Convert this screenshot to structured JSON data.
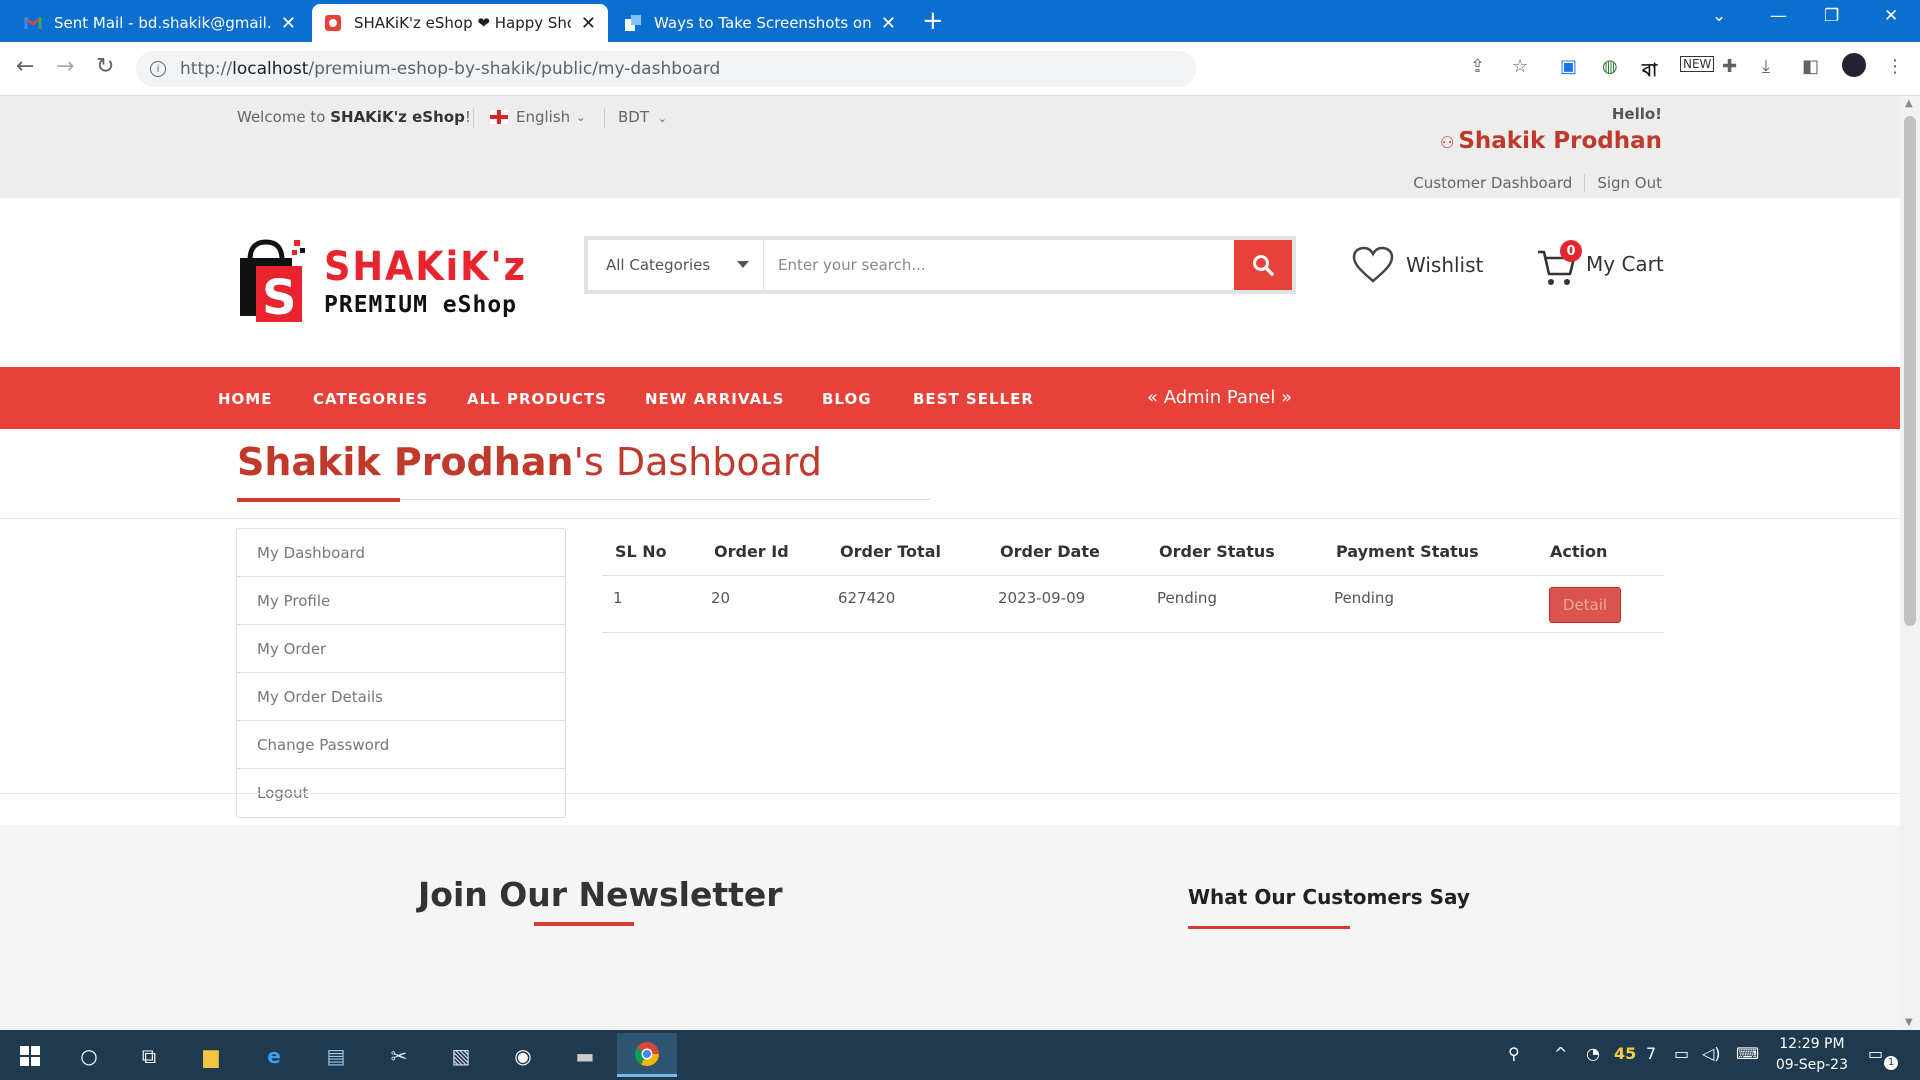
{
  "browser": {
    "tabs": [
      {
        "title": "Sent Mail - bd.shakik@gmail.com",
        "icon": "gmail-icon",
        "active": false
      },
      {
        "title": "SHAKiK'z eShop ❤ Happy Shopping",
        "icon": "shop-icon",
        "active": true
      },
      {
        "title": "Ways to Take Screenshots on Windows",
        "icon": "edge-doc-icon",
        "active": false
      }
    ],
    "url_prefix": "http://",
    "url_host": "localhost",
    "url_path": "/premium-eshop-by-shakik/public/my-dashboard",
    "new_tab": "+"
  },
  "topbar": {
    "welcome_prefix": "Welcome to ",
    "welcome_brand": "SHAKiK'z eShop",
    "welcome_suffix": "!",
    "language": "English",
    "currency": "BDT",
    "hello": "Hello!",
    "user_name": "Shakik Prodhan",
    "links": [
      "Customer Dashboard",
      "Sign Out"
    ]
  },
  "header": {
    "logo_line1": "SHAKiK'z",
    "logo_line2": "PREMIUM eShop",
    "category_select": "All Categories",
    "search_placeholder": "Enter your search...",
    "wishlist": "Wishlist",
    "cart_label": "My Cart",
    "cart_count": "0"
  },
  "nav": {
    "items": [
      "HOME",
      "CATEGORIES",
      "ALL PRODUCTS",
      "NEW ARRIVALS",
      "BLOG",
      "BEST SELLER"
    ],
    "admin": "« Admin Panel »"
  },
  "dashboard": {
    "title_name": "Shakik Prodhan",
    "title_suffix": "'s Dashboard",
    "menu": [
      "My Dashboard",
      "My Profile",
      "My Order",
      "My Order Details",
      "Change Password",
      "Logout"
    ],
    "table": {
      "headers": [
        "SL No",
        "Order Id",
        "Order Total",
        "Order Date",
        "Order Status",
        "Payment Status",
        "Action"
      ],
      "rows": [
        {
          "sl": "1",
          "order_id": "20",
          "total": "627420",
          "date": "2023-09-09",
          "status": "Pending",
          "payment": "Pending",
          "action": "Detail"
        }
      ]
    }
  },
  "footer": {
    "newsletter_title": "Join Our Newsletter",
    "customers_title": "What Our Customers Say"
  },
  "taskbar": {
    "temperature": "45",
    "notif_count": "7",
    "time": "12:29 PM",
    "date": "09-Sep-23",
    "action_center_badge": "1"
  },
  "colors": {
    "brand_red": "#e8413a",
    "title_red": "#c0392b",
    "chrome_blue": "#0b6fcf",
    "taskbar": "#1f3a4f"
  }
}
